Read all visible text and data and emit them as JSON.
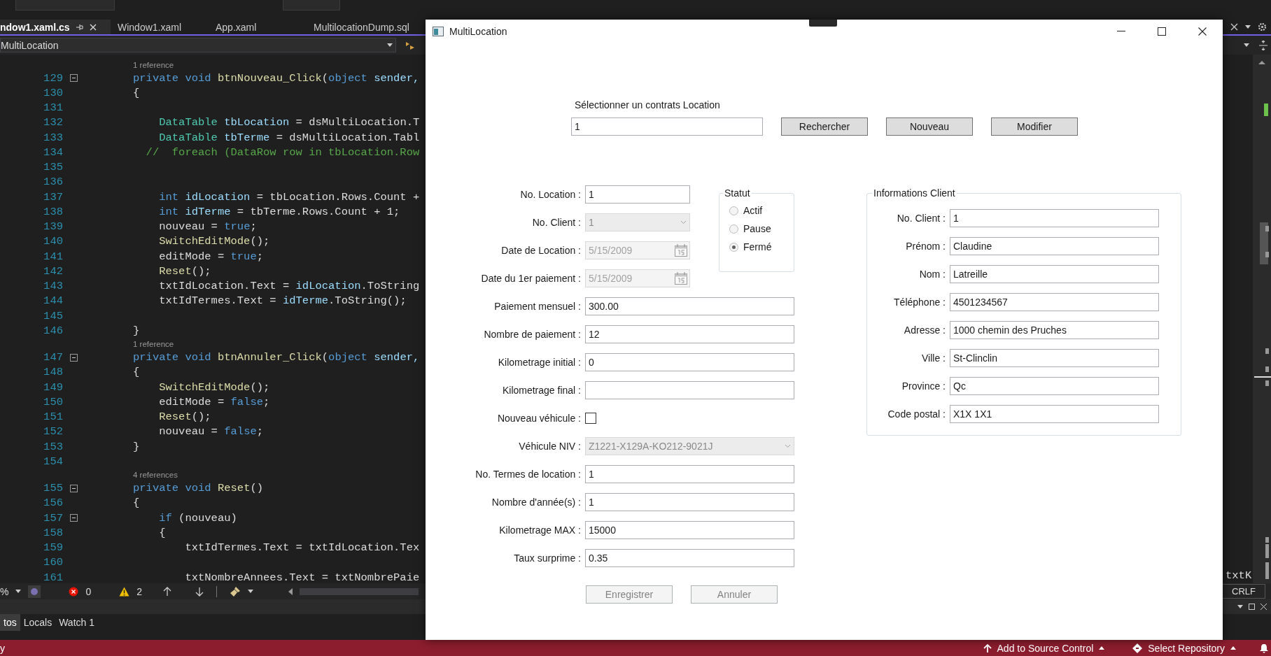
{
  "ide": {
    "tabs": [
      {
        "label": "ndow1.xaml.cs",
        "selected": true
      },
      {
        "label": "Window1.xaml",
        "selected": false
      },
      {
        "label": "App.xaml",
        "selected": false
      },
      {
        "label": "MultilocationDump.sql",
        "selected": false
      }
    ],
    "scope": "MultiLocation",
    "code": [
      {
        "n": "129",
        "lens": "1 reference",
        "fold": true,
        "tokens": [
          {
            "t": "private void",
            "color": "#569cd6"
          },
          {
            "t": " btnNouveau_Click",
            "color": "#dcdcaa"
          },
          {
            "t": "(",
            "color": "#dcdcdc"
          },
          {
            "t": "object",
            "color": "#569cd6"
          },
          {
            "t": " sender,",
            "color": "#9cdcfe"
          }
        ]
      },
      {
        "n": "130",
        "fold": false,
        "tokens": [
          {
            "t": "{",
            "color": "#dcdcdc"
          }
        ]
      },
      {
        "n": "131",
        "fold": false
      },
      {
        "n": "132",
        "fold": false,
        "tokens": [
          {
            "t": "    DataTable",
            "color": "#4ec9b0"
          },
          {
            "t": " tbLocation",
            "color": "#9cdcfe"
          },
          {
            "t": " = dsMultiLocation.T",
            "color": "#dcdcdc"
          }
        ]
      },
      {
        "n": "133",
        "fold": false,
        "tokens": [
          {
            "t": "    DataTable",
            "color": "#4ec9b0"
          },
          {
            "t": " tbTerme",
            "color": "#9cdcfe"
          },
          {
            "t": " = dsMultiLocation.Tabl",
            "color": "#dcdcdc"
          }
        ]
      },
      {
        "n": "134",
        "fold": false,
        "tokens": [
          {
            "t": "  //  foreach (DataRow row in tbLocation.Row",
            "color": "#57a64a"
          }
        ]
      },
      {
        "n": "135",
        "fold": false
      },
      {
        "n": "136",
        "fold": false
      },
      {
        "n": "137",
        "fold": false,
        "tokens": [
          {
            "t": "    int",
            "color": "#569cd6"
          },
          {
            "t": " idLocation",
            "color": "#9cdcfe"
          },
          {
            "t": " = tbLocation.Rows.Count +",
            "color": "#dcdcdc"
          }
        ]
      },
      {
        "n": "138",
        "fold": false,
        "tokens": [
          {
            "t": "    int",
            "color": "#569cd6"
          },
          {
            "t": " idTerme",
            "color": "#9cdcfe"
          },
          {
            "t": " = tbTerme.Rows.Count + 1;",
            "color": "#dcdcdc"
          }
        ]
      },
      {
        "n": "139",
        "fold": false,
        "tokens": [
          {
            "t": "    nouveau =",
            "color": "#dcdcdc"
          },
          {
            "t": " true",
            "color": "#569cd6"
          },
          {
            "t": ";",
            "color": "#dcdcdc"
          }
        ]
      },
      {
        "n": "140",
        "fold": false,
        "tokens": [
          {
            "t": "    SwitchEditMode",
            "color": "#dcdcaa"
          },
          {
            "t": "();",
            "color": "#dcdcdc"
          }
        ]
      },
      {
        "n": "141",
        "fold": false,
        "tokens": [
          {
            "t": "    editMode =",
            "color": "#dcdcdc"
          },
          {
            "t": " true",
            "color": "#569cd6"
          },
          {
            "t": ";",
            "color": "#dcdcdc"
          }
        ]
      },
      {
        "n": "142",
        "fold": false,
        "tokens": [
          {
            "t": "    Reset",
            "color": "#dcdcaa"
          },
          {
            "t": "();",
            "color": "#dcdcdc"
          }
        ]
      },
      {
        "n": "143",
        "fold": false,
        "tokens": [
          {
            "t": "    txtIdLocation.Text =",
            "color": "#dcdcdc"
          },
          {
            "t": " idLocation",
            "color": "#9cdcfe"
          },
          {
            "t": ".ToString",
            "color": "#dcdcdc"
          }
        ]
      },
      {
        "n": "144",
        "fold": false,
        "tokens": [
          {
            "t": "    txtIdTermes.Text =",
            "color": "#dcdcdc"
          },
          {
            "t": " idTerme",
            "color": "#9cdcfe"
          },
          {
            "t": ".ToString();",
            "color": "#dcdcdc"
          }
        ]
      },
      {
        "n": "145",
        "fold": false
      },
      {
        "n": "146",
        "fold": false,
        "tokens": [
          {
            "t": "}",
            "color": "#dcdcdc"
          }
        ]
      },
      {
        "n": "147",
        "lens": "1 reference",
        "fold": true,
        "tokens": [
          {
            "t": "private void",
            "color": "#569cd6"
          },
          {
            "t": " btnAnnuler_Click",
            "color": "#dcdcaa"
          },
          {
            "t": "(",
            "color": "#dcdcdc"
          },
          {
            "t": "object",
            "color": "#569cd6"
          },
          {
            "t": " sender,",
            "color": "#9cdcfe"
          }
        ]
      },
      {
        "n": "148",
        "fold": false,
        "tokens": [
          {
            "t": "{",
            "color": "#dcdcdc"
          }
        ]
      },
      {
        "n": "149",
        "fold": false,
        "tokens": [
          {
            "t": "    SwitchEditMode",
            "color": "#dcdcaa"
          },
          {
            "t": "();",
            "color": "#dcdcdc"
          }
        ]
      },
      {
        "n": "150",
        "fold": false,
        "tokens": [
          {
            "t": "    editMode =",
            "color": "#dcdcdc"
          },
          {
            "t": " false",
            "color": "#569cd6"
          },
          {
            "t": ";",
            "color": "#dcdcdc"
          }
        ]
      },
      {
        "n": "151",
        "fold": false,
        "tokens": [
          {
            "t": "    Reset",
            "color": "#dcdcaa"
          },
          {
            "t": "();",
            "color": "#dcdcdc"
          }
        ]
      },
      {
        "n": "152",
        "fold": false,
        "tokens": [
          {
            "t": "    nouveau =",
            "color": "#dcdcdc"
          },
          {
            "t": " false",
            "color": "#569cd6"
          },
          {
            "t": ";",
            "color": "#dcdcdc"
          }
        ]
      },
      {
        "n": "153",
        "fold": false,
        "tokens": [
          {
            "t": "}",
            "color": "#dcdcdc"
          }
        ]
      },
      {
        "n": "154",
        "fold": false
      },
      {
        "n": "155",
        "lens": "4 references",
        "fold": true,
        "tokens": [
          {
            "t": "private void",
            "color": "#569cd6"
          },
          {
            "t": " Reset",
            "color": "#dcdcaa"
          },
          {
            "t": "()",
            "color": "#dcdcdc"
          }
        ]
      },
      {
        "n": "156",
        "fold": false,
        "tokens": [
          {
            "t": "{",
            "color": "#dcdcdc"
          }
        ]
      },
      {
        "n": "157",
        "fold": true,
        "tokens": [
          {
            "t": "    if",
            "color": "#569cd6"
          },
          {
            "t": " (nouveau)",
            "color": "#dcdcdc"
          }
        ]
      },
      {
        "n": "158",
        "fold": false,
        "tokens": [
          {
            "t": "    {",
            "color": "#dcdcdc"
          }
        ]
      },
      {
        "n": "159",
        "fold": false,
        "tokens": [
          {
            "t": "        txtIdTermes.Text = txtIdLocation.Tex",
            "color": "#dcdcdc"
          }
        ]
      },
      {
        "n": "160",
        "fold": false
      },
      {
        "n": "161",
        "fold": false,
        "tokens": [
          {
            "t": "        txtNombreAnnees.Text = txtNombrePaie",
            "color": "#dcdcdc"
          }
        ]
      }
    ],
    "overflow_text": "txtK",
    "editor_bar": {
      "zoom": "%",
      "errors": "0",
      "warnings": "2",
      "line_ending": "CRLF"
    },
    "panel_tabs": [
      {
        "label": "tos",
        "selected": true
      },
      {
        "label": "Locals",
        "selected": false
      },
      {
        "label": "Watch 1",
        "selected": false
      }
    ],
    "status_bar": {
      "left": "y",
      "source_control": "Add to Source Control",
      "repository": "Select Repository"
    }
  },
  "window": {
    "title": "MultiLocation",
    "search": {
      "label": "Sélectionner un contrats Location",
      "value": "1"
    },
    "actions": [
      {
        "label": "Rechercher",
        "disabled": false
      },
      {
        "label": "Nouveau",
        "disabled": false
      },
      {
        "label": "Modifier",
        "disabled": false
      }
    ],
    "fields_top": [
      {
        "kind": "text",
        "label": "No. Location :",
        "value": "1",
        "disabled": false
      },
      {
        "kind": "combo",
        "label": "No. Client :",
        "value": "1",
        "disabled": true
      },
      {
        "kind": "date",
        "label": "Date de Location :",
        "value": "5/15/2009",
        "disabled": true
      },
      {
        "kind": "date",
        "label": "Date du 1er paiement :",
        "value": "5/15/2009",
        "disabled": true
      }
    ],
    "status": {
      "legend": "Statut",
      "options": [
        {
          "label": "Actif",
          "selected": false
        },
        {
          "label": "Pause",
          "selected": false
        },
        {
          "label": "Fermé",
          "selected": true
        }
      ]
    },
    "fields": [
      {
        "kind": "text",
        "label": "Paiement mensuel :",
        "value": "300.00",
        "disabled": false
      },
      {
        "kind": "text",
        "label": "Nombre de paiement :",
        "value": "12",
        "disabled": false
      },
      {
        "kind": "text",
        "label": "Kilometrage initial :",
        "value": "0",
        "disabled": false
      },
      {
        "kind": "text",
        "label": "Kilometrage final :",
        "disabled": false
      },
      {
        "kind": "checkbox",
        "label": "Nouveau véhicule :",
        "checked": false,
        "disabled": false
      },
      {
        "kind": "combo",
        "label": "Véhicule NIV :",
        "value": "Z1221-X129A-KO212-9021J",
        "disabled": true
      },
      {
        "kind": "text",
        "label": "No. Termes de location :",
        "value": "1",
        "disabled": false
      },
      {
        "kind": "text",
        "label": "Nombre d'année(s) :",
        "value": "1",
        "disabled": false
      },
      {
        "kind": "text",
        "label": "Kilometrage MAX :",
        "value": "15000",
        "disabled": false
      },
      {
        "kind": "text",
        "label": "Taux surprime :",
        "value": "0.35",
        "disabled": false
      }
    ],
    "client": {
      "legend": "Informations Client",
      "fields": [
        {
          "label": "No. Client :",
          "value": "1"
        },
        {
          "label": "Prénom :",
          "value": "Claudine"
        },
        {
          "label": "Nom :",
          "value": "Latreille"
        },
        {
          "label": "Téléphone :",
          "value": "4501234567"
        },
        {
          "label": "Adresse :",
          "value": "1000 chemin des Pruches"
        },
        {
          "label": "Ville :",
          "value": "St-Clinclin"
        },
        {
          "label": "Province :",
          "value": "Qc"
        },
        {
          "label": "Code postal :",
          "value": "X1X 1X1"
        }
      ]
    },
    "footer_buttons": [
      {
        "label": "Enregistrer",
        "disabled": true
      },
      {
        "label": "Annuler",
        "disabled": true
      }
    ]
  }
}
